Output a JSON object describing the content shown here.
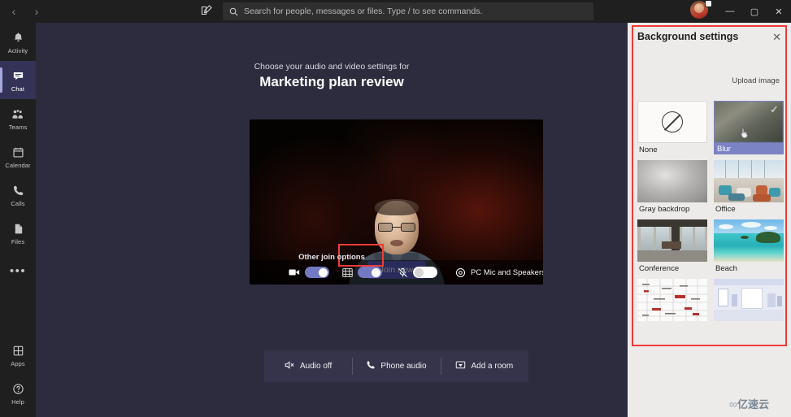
{
  "titlebar": {
    "back_icon": "‹",
    "forward_icon": "›",
    "compose_icon": "compose-icon",
    "search": {
      "icon": "search-icon",
      "placeholder": "Search for people, messages or files. Type / to see commands."
    },
    "avatar_label": "user-avatar",
    "minimize_label": "—",
    "maximize_label": "▢",
    "close_label": "✕"
  },
  "rail": {
    "items": [
      {
        "label": "Activity",
        "icon": "bell-icon",
        "active": false
      },
      {
        "label": "Chat",
        "icon": "chat-icon",
        "active": true
      },
      {
        "label": "Teams",
        "icon": "teams-icon",
        "active": false
      },
      {
        "label": "Calendar",
        "icon": "calendar-icon",
        "active": false
      },
      {
        "label": "Calls",
        "icon": "phone-icon",
        "active": false
      },
      {
        "label": "Files",
        "icon": "file-icon",
        "active": false
      }
    ],
    "more_label": "•••",
    "bottom_items": [
      {
        "label": "Apps",
        "icon": "apps-icon"
      },
      {
        "label": "Help",
        "icon": "help-icon"
      }
    ]
  },
  "prejoin": {
    "subhead": "Choose your audio and video settings for",
    "meeting_title": "Marketing plan review",
    "join_now_label": "Join now",
    "controls": {
      "camera": {
        "icon": "camera-icon",
        "state": "on"
      },
      "background_effects": {
        "icon": "background-effects-icon",
        "state": "on",
        "highlighted": true
      },
      "microphone": {
        "icon": "microphone-muted-icon",
        "state": "off"
      },
      "device": {
        "icon": "device-settings-icon",
        "label": "PC Mic and Speakers"
      }
    },
    "other_join_options_label": "Other join options",
    "other_join_options": [
      {
        "label": "Audio off",
        "icon": "audio-off-icon"
      },
      {
        "label": "Phone audio",
        "icon": "phone-icon"
      },
      {
        "label": "Add a room",
        "icon": "add-room-icon"
      }
    ]
  },
  "background_panel": {
    "title": "Background settings",
    "close_icon": "close-icon",
    "upload_label": "Upload image",
    "selected": "Blur",
    "checkmark": "✓",
    "options": [
      {
        "label": "None",
        "kind": "none",
        "selected": false
      },
      {
        "label": "Blur",
        "kind": "blur",
        "selected": true
      },
      {
        "label": "Gray backdrop",
        "kind": "gray",
        "selected": false
      },
      {
        "label": "Office",
        "kind": "office",
        "selected": false
      },
      {
        "label": "Conference",
        "kind": "conference",
        "selected": false
      },
      {
        "label": "Beach",
        "kind": "beach",
        "selected": false
      },
      {
        "label": "",
        "kind": "map",
        "selected": false
      },
      {
        "label": "",
        "kind": "room",
        "selected": false
      }
    ]
  },
  "watermark": {
    "glyph": "∞",
    "text": "亿速云"
  },
  "colors": {
    "accent_purple": "#5b5fc7",
    "selection_purple": "#7b83c4",
    "highlight_red": "#ef3b38",
    "panel_bg": "#edebe9",
    "stage_bg": "#2d2c3e",
    "rail_bg": "#1f1f1f"
  }
}
